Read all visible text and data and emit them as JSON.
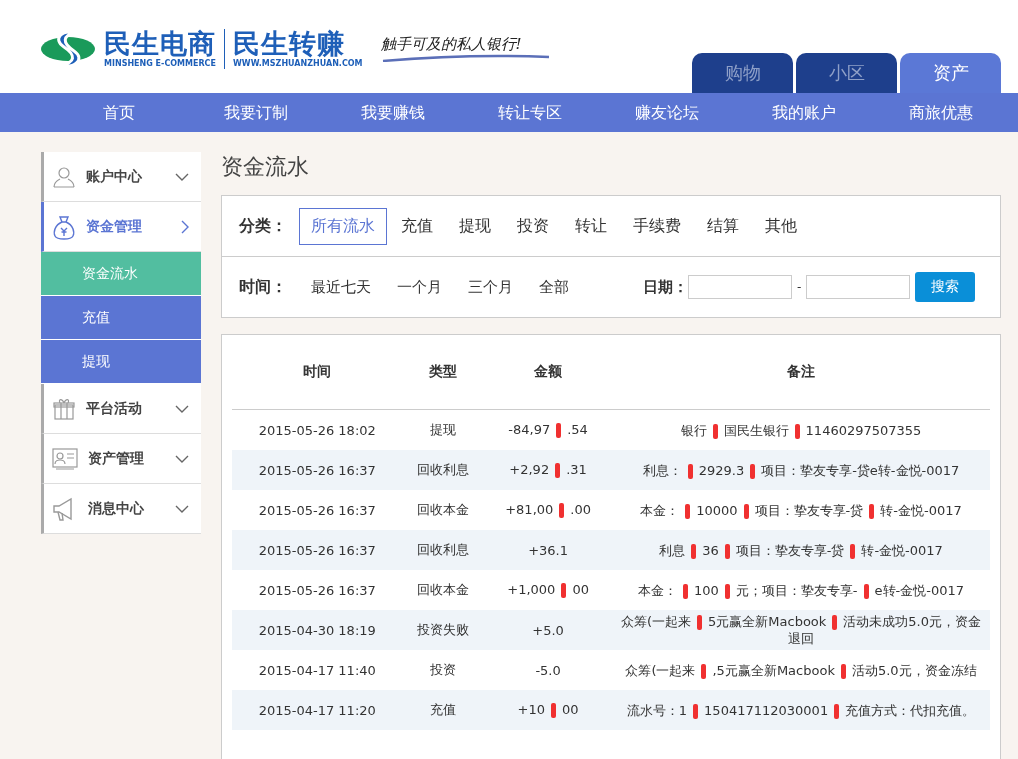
{
  "header": {
    "logo": {
      "name": "民生电商",
      "subtitle": "MINSHENG E-COMMERCE",
      "name2": "民生转赚",
      "url": "WWW.MSZHUANZHUAN.COM",
      "slogan": "触手可及的私人银行!"
    },
    "tabs": [
      {
        "label": "购物",
        "selected": false
      },
      {
        "label": "小区",
        "selected": false
      },
      {
        "label": "资产",
        "selected": true
      }
    ]
  },
  "nav": [
    "首页",
    "我要订制",
    "我要赚钱",
    "转让专区",
    "赚友论坛",
    "我的账户",
    "商旅优惠"
  ],
  "sidebar": [
    {
      "label": "账户中心",
      "expanded": false
    },
    {
      "label": "资金管理",
      "expanded": true,
      "children": [
        {
          "label": "资金流水",
          "selected": true
        },
        {
          "label": "充值",
          "selected": false
        },
        {
          "label": "提现",
          "selected": false
        }
      ]
    },
    {
      "label": "平台活动",
      "expanded": false
    },
    {
      "label": "资产管理",
      "expanded": false
    },
    {
      "label": "消息中心",
      "expanded": false
    }
  ],
  "page_title": "资金流水",
  "filters": {
    "category_label": "分类：",
    "categories": [
      {
        "label": "所有流水",
        "selected": true
      },
      {
        "label": "充值",
        "selected": false
      },
      {
        "label": "提现",
        "selected": false
      },
      {
        "label": "投资",
        "selected": false
      },
      {
        "label": "转让",
        "selected": false
      },
      {
        "label": "手续费",
        "selected": false
      },
      {
        "label": "结算",
        "selected": false
      },
      {
        "label": "其他",
        "selected": false
      }
    ],
    "time_label": "时间：",
    "times": [
      "最近七天",
      "一个月",
      "三个月",
      "全部"
    ],
    "date_label": "日期：",
    "date_separator": "-",
    "search_button": "搜索"
  },
  "table": {
    "columns": [
      "时间",
      "类型",
      "金额",
      "备注"
    ],
    "rows": [
      {
        "time": "2015-05-26 18:02",
        "type": "提现",
        "amount": [
          "-84,97",
          ".54"
        ],
        "note": [
          "银行",
          "国民生银行",
          "11460297507355"
        ]
      },
      {
        "time": "2015-05-26 16:37",
        "type": "回收利息",
        "amount": [
          "+2,92",
          ".31"
        ],
        "note": [
          "利息：",
          "2929.3",
          "项目：挚友专享-贷e转-金悦-0017"
        ]
      },
      {
        "time": "2015-05-26 16:37",
        "type": "回收本金",
        "amount": [
          "+81,00",
          ".00"
        ],
        "note": [
          "本金：",
          "10000",
          "项目：挚友专享-贷",
          "转-金悦-0017"
        ]
      },
      {
        "time": "2015-05-26 16:37",
        "type": "回收利息",
        "amount": [
          "+36.1"
        ],
        "note": [
          "利息",
          "36",
          "项目：挚友专享-贷",
          "转-金悦-0017"
        ]
      },
      {
        "time": "2015-05-26 16:37",
        "type": "回收本金",
        "amount": [
          "+1,000",
          "00"
        ],
        "note": [
          "本金：",
          "100",
          "元；项目：挚友专享-",
          "e转-金悦-0017"
        ]
      },
      {
        "time": "2015-04-30 18:19",
        "type": "投资失败",
        "amount": [
          "+5.0"
        ],
        "note": [
          "众筹(一起来",
          "5元赢全新Macbook",
          "活动未成功5.0元，资金退回"
        ]
      },
      {
        "time": "2015-04-17 11:40",
        "type": "投资",
        "amount": [
          "-5.0"
        ],
        "note": [
          "众筹(一起来",
          ",5元赢全新Macbook",
          "活动5.0元，资金冻结"
        ]
      },
      {
        "time": "2015-04-17 11:20",
        "type": "充值",
        "amount": [
          "+10",
          "00"
        ],
        "note": [
          "流水号：1",
          "150417112030001",
          "充值方式：代扣充值。"
        ]
      }
    ]
  }
}
